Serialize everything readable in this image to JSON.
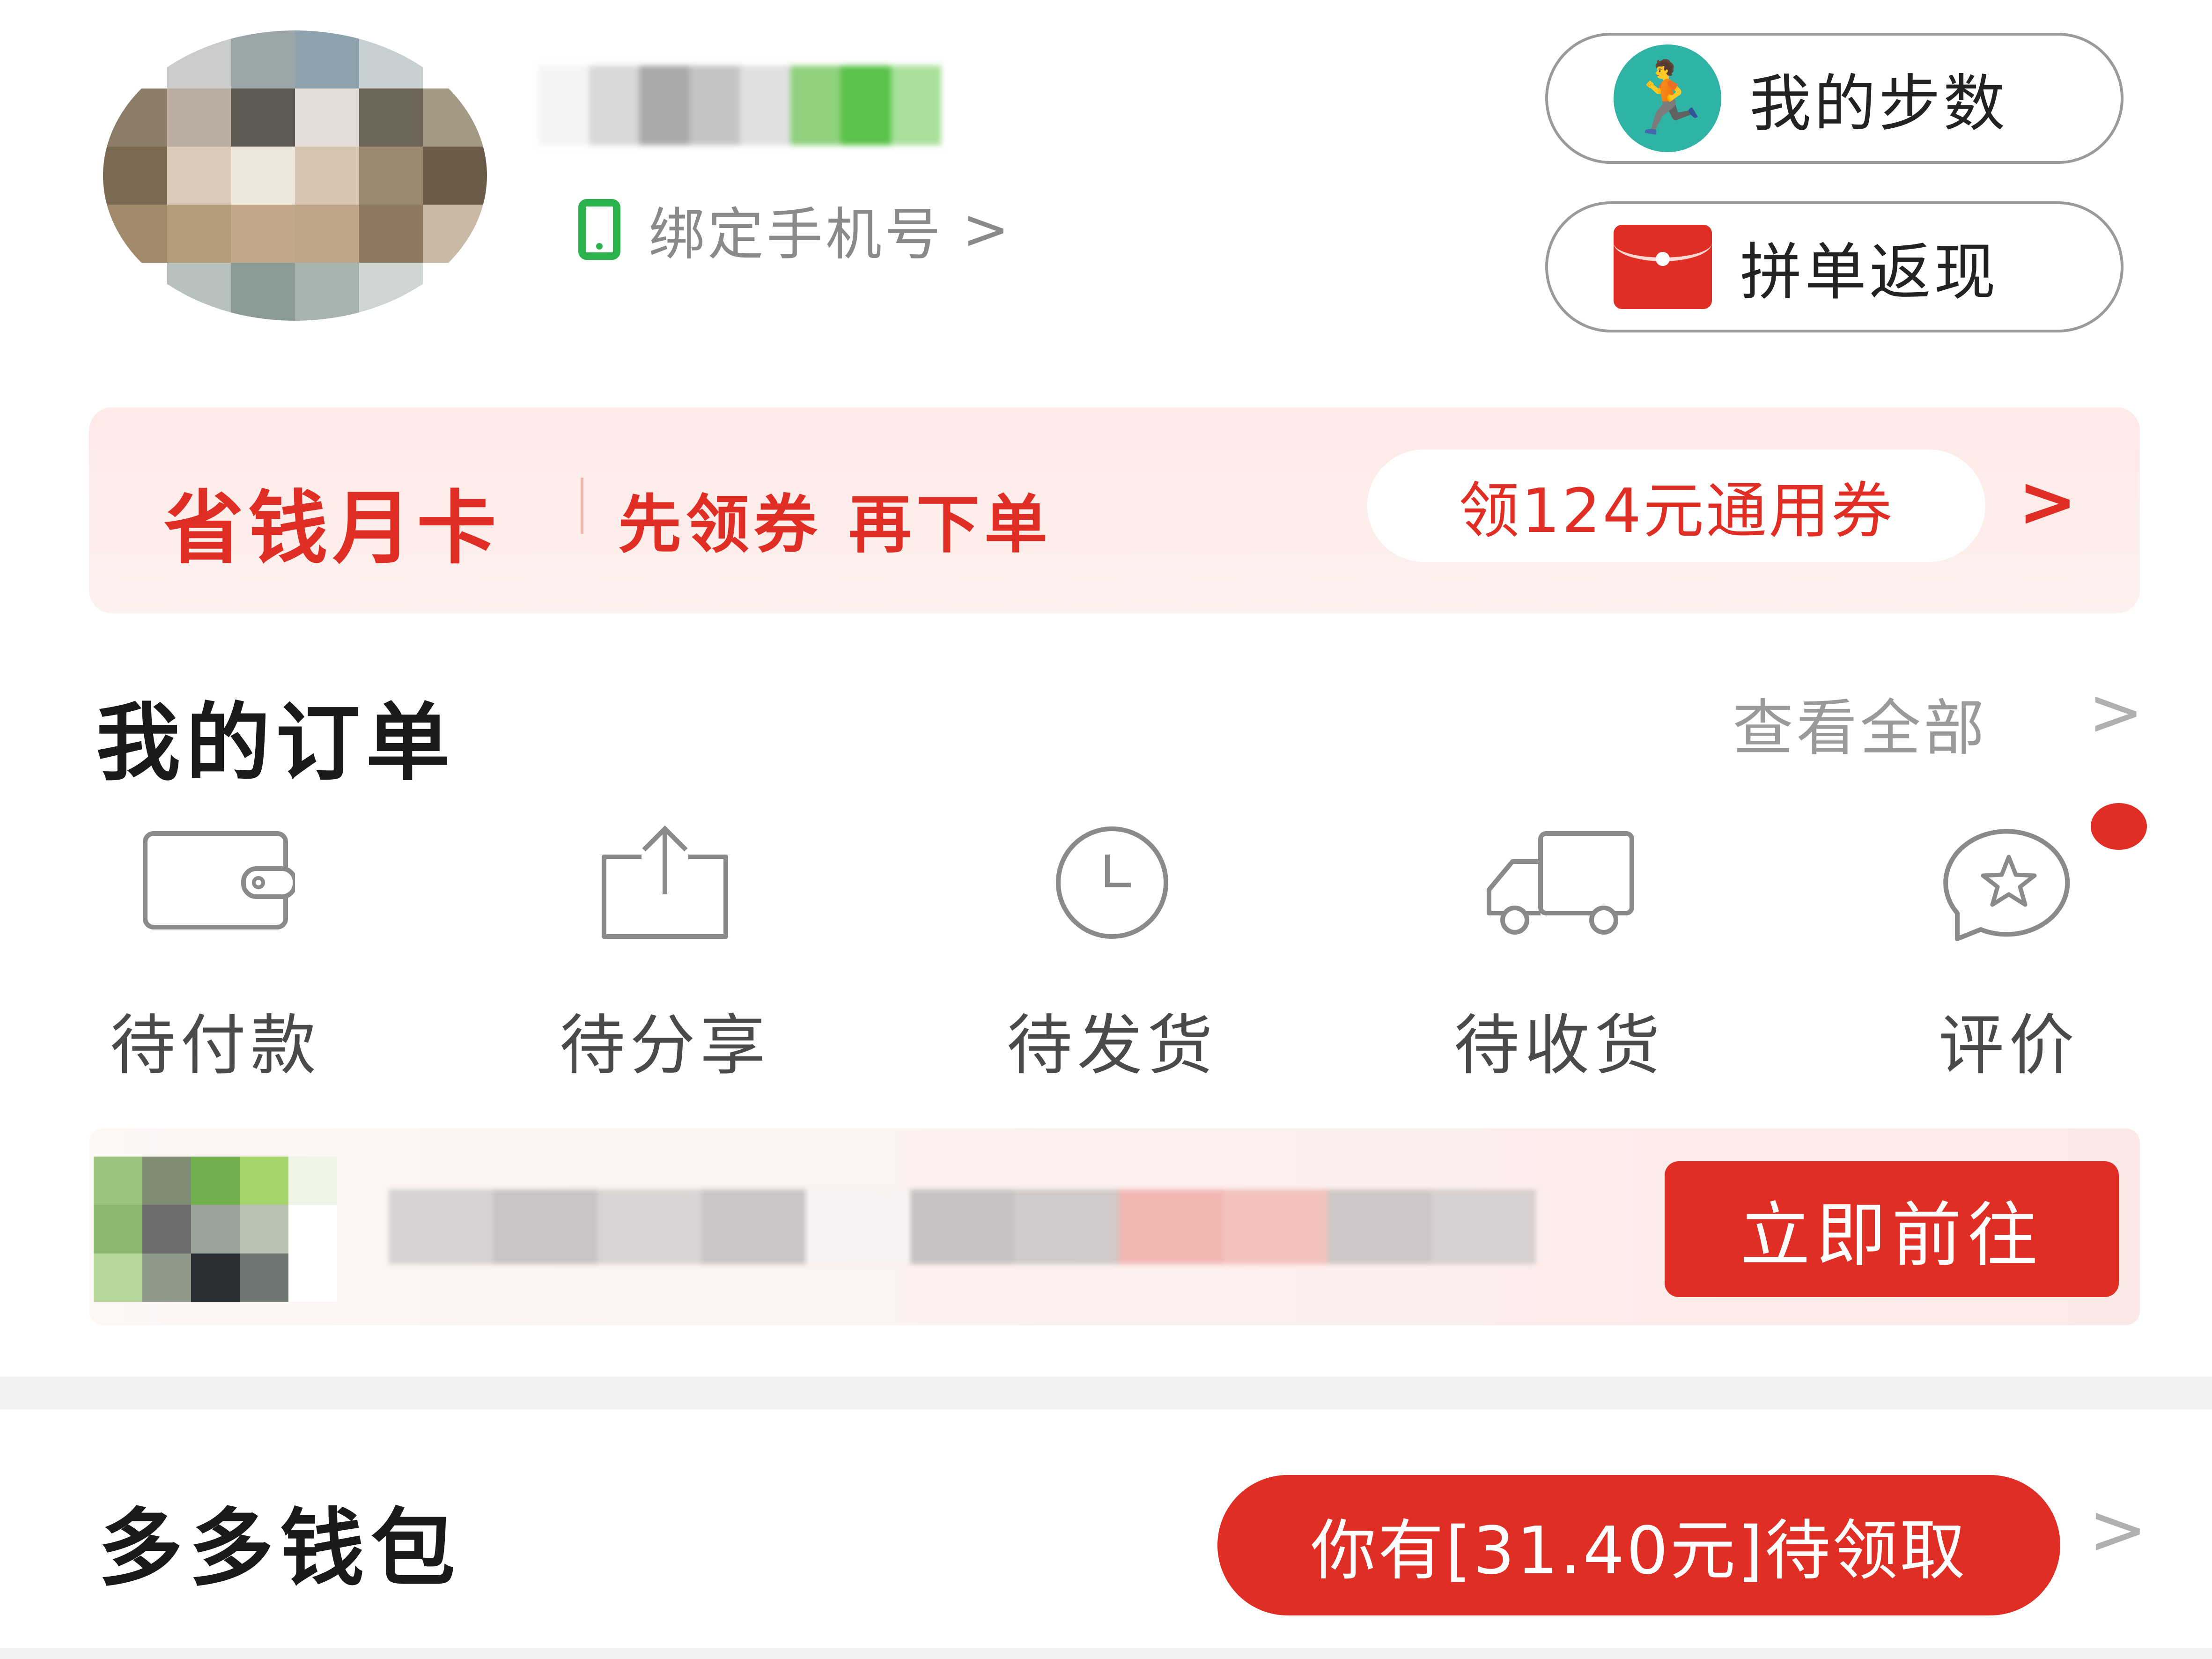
{
  "header": {
    "bind_phone_label": "绑定手机号",
    "bind_phone_chevron": ">",
    "steps_label": "我的步数",
    "cashback_label": "拼单返现"
  },
  "saving_card": {
    "title": "省钱月卡",
    "subtitle": "先领券 再下单",
    "coupon_label": "领124元通用券",
    "chevron": ">"
  },
  "orders": {
    "title": "我的订单",
    "view_all": "查看全部",
    "view_all_chevron": ">",
    "items": [
      {
        "label": "待付款",
        "icon": "wallet-icon"
      },
      {
        "label": "待分享",
        "icon": "share-icon"
      },
      {
        "label": "待发货",
        "icon": "clock-icon"
      },
      {
        "label": "待收货",
        "icon": "truck-icon"
      },
      {
        "label": "评价",
        "icon": "review-star-icon"
      }
    ]
  },
  "promo": {
    "button_label": "立即前往"
  },
  "wallet": {
    "title": "多多钱包",
    "badge_text": "你有[31.40元]待领取",
    "chevron": ">"
  },
  "colors": {
    "accent_red": "#e02e24",
    "teal": "#2fb3a4",
    "green": "#2bb24c",
    "muted_text": "#9a9a9a"
  }
}
